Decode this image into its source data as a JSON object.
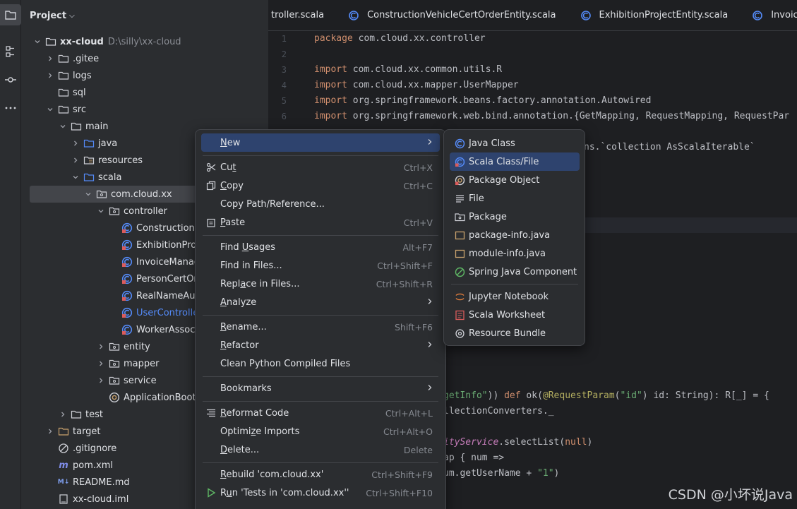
{
  "project_panel": {
    "title": "Project",
    "tree": [
      {
        "label": "xx-cloud",
        "hint": "D:\\silly\\xx-cloud",
        "type": "module",
        "expanded": true
      },
      {
        "label": ".gitee",
        "type": "folder"
      },
      {
        "label": "logs",
        "type": "folder"
      },
      {
        "label": "sql",
        "type": "folder"
      },
      {
        "label": "src",
        "type": "folder",
        "expanded": true
      },
      {
        "label": "main",
        "type": "folder",
        "expanded": true
      },
      {
        "label": "java",
        "type": "source-folder"
      },
      {
        "label": "resources",
        "type": "resource-folder"
      },
      {
        "label": "scala",
        "type": "source-folder",
        "expanded": true
      },
      {
        "label": "com.cloud.xx",
        "type": "package",
        "expanded": true
      },
      {
        "label": "controller",
        "type": "package",
        "expanded": true
      },
      {
        "label": "ConstructionV",
        "type": "scala-class"
      },
      {
        "label": "ExhibitionProj",
        "type": "scala-class"
      },
      {
        "label": "InvoiceManag",
        "type": "scala-class"
      },
      {
        "label": "PersonCertOr",
        "type": "scala-class"
      },
      {
        "label": "RealNameAut",
        "type": "scala-class"
      },
      {
        "label": "UserControlle",
        "type": "scala-class",
        "highlight": true
      },
      {
        "label": "WorkerAssoci",
        "type": "scala-class"
      },
      {
        "label": "entity",
        "type": "package"
      },
      {
        "label": "mapper",
        "type": "package"
      },
      {
        "label": "service",
        "type": "package"
      },
      {
        "label": "ApplicationBoot",
        "type": "scala-object"
      },
      {
        "label": "test",
        "type": "folder"
      },
      {
        "label": "target",
        "type": "excluded-folder"
      },
      {
        "label": ".gitignore",
        "type": "gitignore"
      },
      {
        "label": "pom.xml",
        "type": "maven"
      },
      {
        "label": "README.md",
        "type": "markdown"
      },
      {
        "label": "xx-cloud.iml",
        "type": "iml"
      }
    ]
  },
  "tabs": [
    {
      "label": "troller.scala"
    },
    {
      "label": "ConstructionVehicleCertOrderEntity.scala"
    },
    {
      "label": "ExhibitionProjectEntity.scala"
    },
    {
      "label": "InvoiceManager"
    }
  ],
  "editor": {
    "line_numbers": [
      "1",
      "2",
      "3",
      "4",
      "5",
      "6"
    ],
    "lines": {
      "l1": "package com.cloud.xx.controller",
      "l3": "import com.cloud.xx.common.utils.R",
      "l4": "import com.cloud.xx.mapper.UserMapper",
      "l5": "import org.springframework.beans.factory.annotation.Autowired",
      "l6": "import org.springframework.web.bind.annotation.{GetMapping, RequestMapping, RequestPar",
      "l8": "ns.`collection AsScalaIterable`",
      "l23": "getInfo\")) def ok(@RequestParam(\"id\") id: String): R[_] = {",
      "l24": "llectionConverters._",
      "l26": "ityService.selectList(null)",
      "l27": "ap { num =>",
      "l28": "um.getUserName + \"1\")"
    },
    "kw_import": "import",
    "kw_package": "package",
    "kw_def": "def"
  },
  "context_menu": {
    "items": [
      {
        "label": "New",
        "submenu": true
      },
      {
        "label": "Cut",
        "shortcut": "Ctrl+X",
        "icon": "scissors-icon"
      },
      {
        "label": "Copy",
        "shortcut": "Ctrl+C",
        "icon": "copy-icon"
      },
      {
        "label": "Copy Path/Reference..."
      },
      {
        "label": "Paste",
        "shortcut": "Ctrl+V",
        "icon": "paste-icon"
      },
      {
        "label": "Find Usages",
        "shortcut": "Alt+F7"
      },
      {
        "label": "Find in Files...",
        "shortcut": "Ctrl+Shift+F"
      },
      {
        "label": "Replace in Files...",
        "shortcut": "Ctrl+Shift+R"
      },
      {
        "label": "Analyze",
        "submenu": true
      },
      {
        "label": "Rename...",
        "shortcut": "Shift+F6"
      },
      {
        "label": "Refactor",
        "submenu": true
      },
      {
        "label": "Clean Python Compiled Files"
      },
      {
        "label": "Bookmarks",
        "submenu": true
      },
      {
        "label": "Reformat Code",
        "shortcut": "Ctrl+Alt+L",
        "icon": "reformat-icon"
      },
      {
        "label": "Optimize Imports",
        "shortcut": "Ctrl+Alt+O"
      },
      {
        "label": "Delete...",
        "shortcut": "Delete"
      },
      {
        "label": "Rebuild 'com.cloud.xx'",
        "shortcut": "Ctrl+Shift+F9"
      },
      {
        "label": "Run 'Tests in 'com.cloud.xx''",
        "shortcut": "Ctrl+Shift+F10",
        "icon": "run-icon"
      }
    ]
  },
  "new_submenu": {
    "items": [
      {
        "label": "Java Class"
      },
      {
        "label": "Scala Class/File",
        "selected": true
      },
      {
        "label": "Package Object"
      },
      {
        "label": "File"
      },
      {
        "label": "Package"
      },
      {
        "label": "package-info.java"
      },
      {
        "label": "module-info.java"
      },
      {
        "label": "Spring Java Component"
      },
      {
        "label": "Jupyter Notebook"
      },
      {
        "label": "Scala Worksheet"
      },
      {
        "label": "Resource Bundle"
      }
    ]
  },
  "watermark": "CSDN @小坏说Java",
  "colors": {
    "selection": "#2e436e",
    "accent_blue": "#548af7",
    "scala_red": "#db5c5c"
  }
}
